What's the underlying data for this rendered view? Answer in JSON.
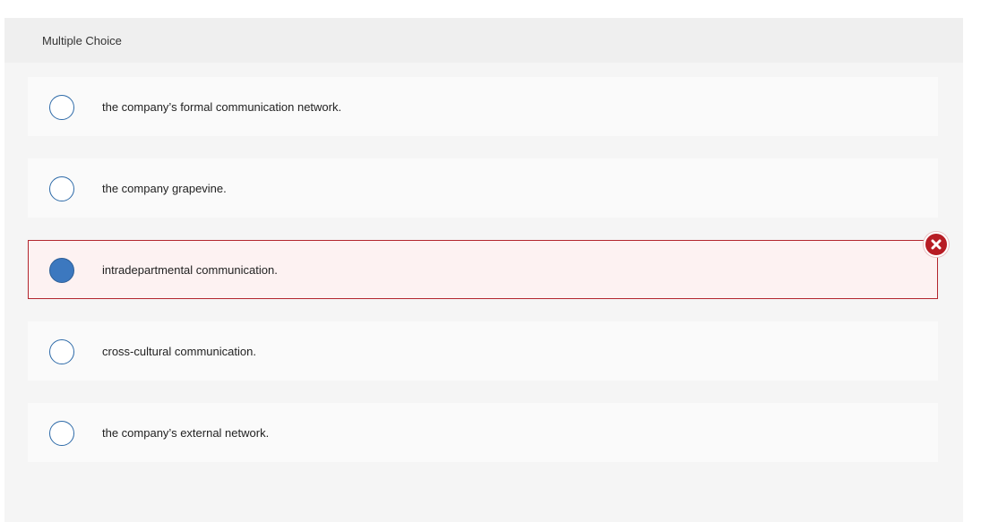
{
  "question": {
    "type_label": "Multiple Choice"
  },
  "options": [
    {
      "text": "the company’s formal communication network.",
      "selected": false
    },
    {
      "text": "the company grapevine.",
      "selected": false
    },
    {
      "text": "intradepartmental communication.",
      "selected": true,
      "status": "incorrect"
    },
    {
      "text": "cross-cultural communication.",
      "selected": false
    },
    {
      "text": "the company’s external network.",
      "selected": false
    }
  ],
  "feedback": {
    "icon": "close-icon",
    "status": "incorrect"
  },
  "colors": {
    "radio_border": "#2d6aa8",
    "radio_selected_fill": "#3c78bf",
    "incorrect_accent": "#b71c24",
    "incorrect_background": "#fdf2f2",
    "option_background": "#fafafa",
    "panel_background": "#f5f5f5",
    "header_background": "#efefef"
  }
}
